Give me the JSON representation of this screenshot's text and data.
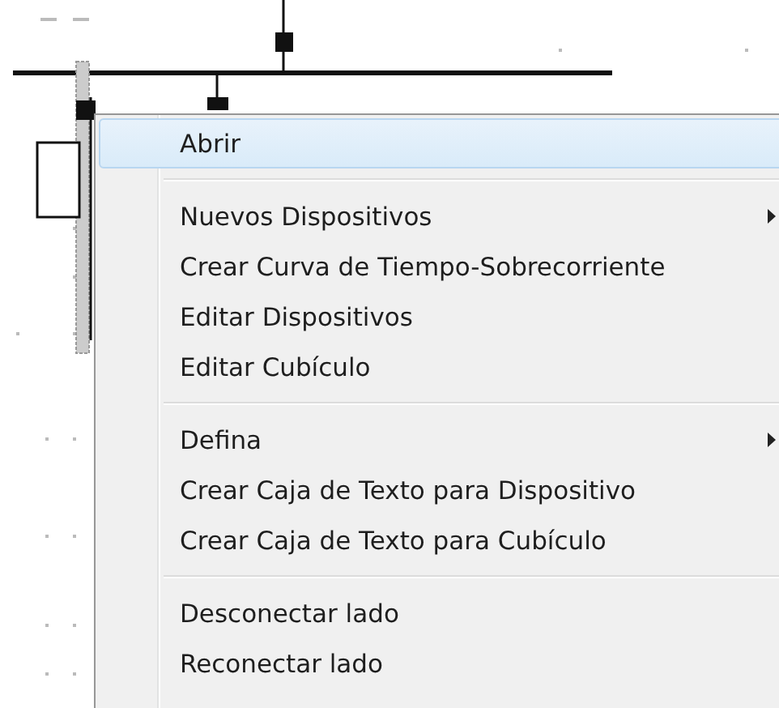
{
  "context_menu": {
    "groups": [
      {
        "items": [
          {
            "label": "Abrir",
            "selected": true,
            "has_submenu": false
          }
        ]
      },
      {
        "items": [
          {
            "label": "Nuevos Dispositivos",
            "selected": false,
            "has_submenu": true
          },
          {
            "label": "Crear Curva de Tiempo-Sobrecorriente",
            "selected": false,
            "has_submenu": false
          },
          {
            "label": "Editar Dispositivos",
            "selected": false,
            "has_submenu": false
          },
          {
            "label": "Editar Cubículo",
            "selected": false,
            "has_submenu": false
          }
        ]
      },
      {
        "items": [
          {
            "label": "Defina",
            "selected": false,
            "has_submenu": true
          },
          {
            "label": "Crear Caja de Texto para Dispositivo",
            "selected": false,
            "has_submenu": false
          },
          {
            "label": "Crear Caja de Texto para Cubículo",
            "selected": false,
            "has_submenu": false
          }
        ]
      },
      {
        "items": [
          {
            "label": "Desconectar lado",
            "selected": false,
            "has_submenu": false
          },
          {
            "label": "Reconectar lado",
            "selected": false,
            "has_submenu": false
          }
        ]
      }
    ]
  }
}
